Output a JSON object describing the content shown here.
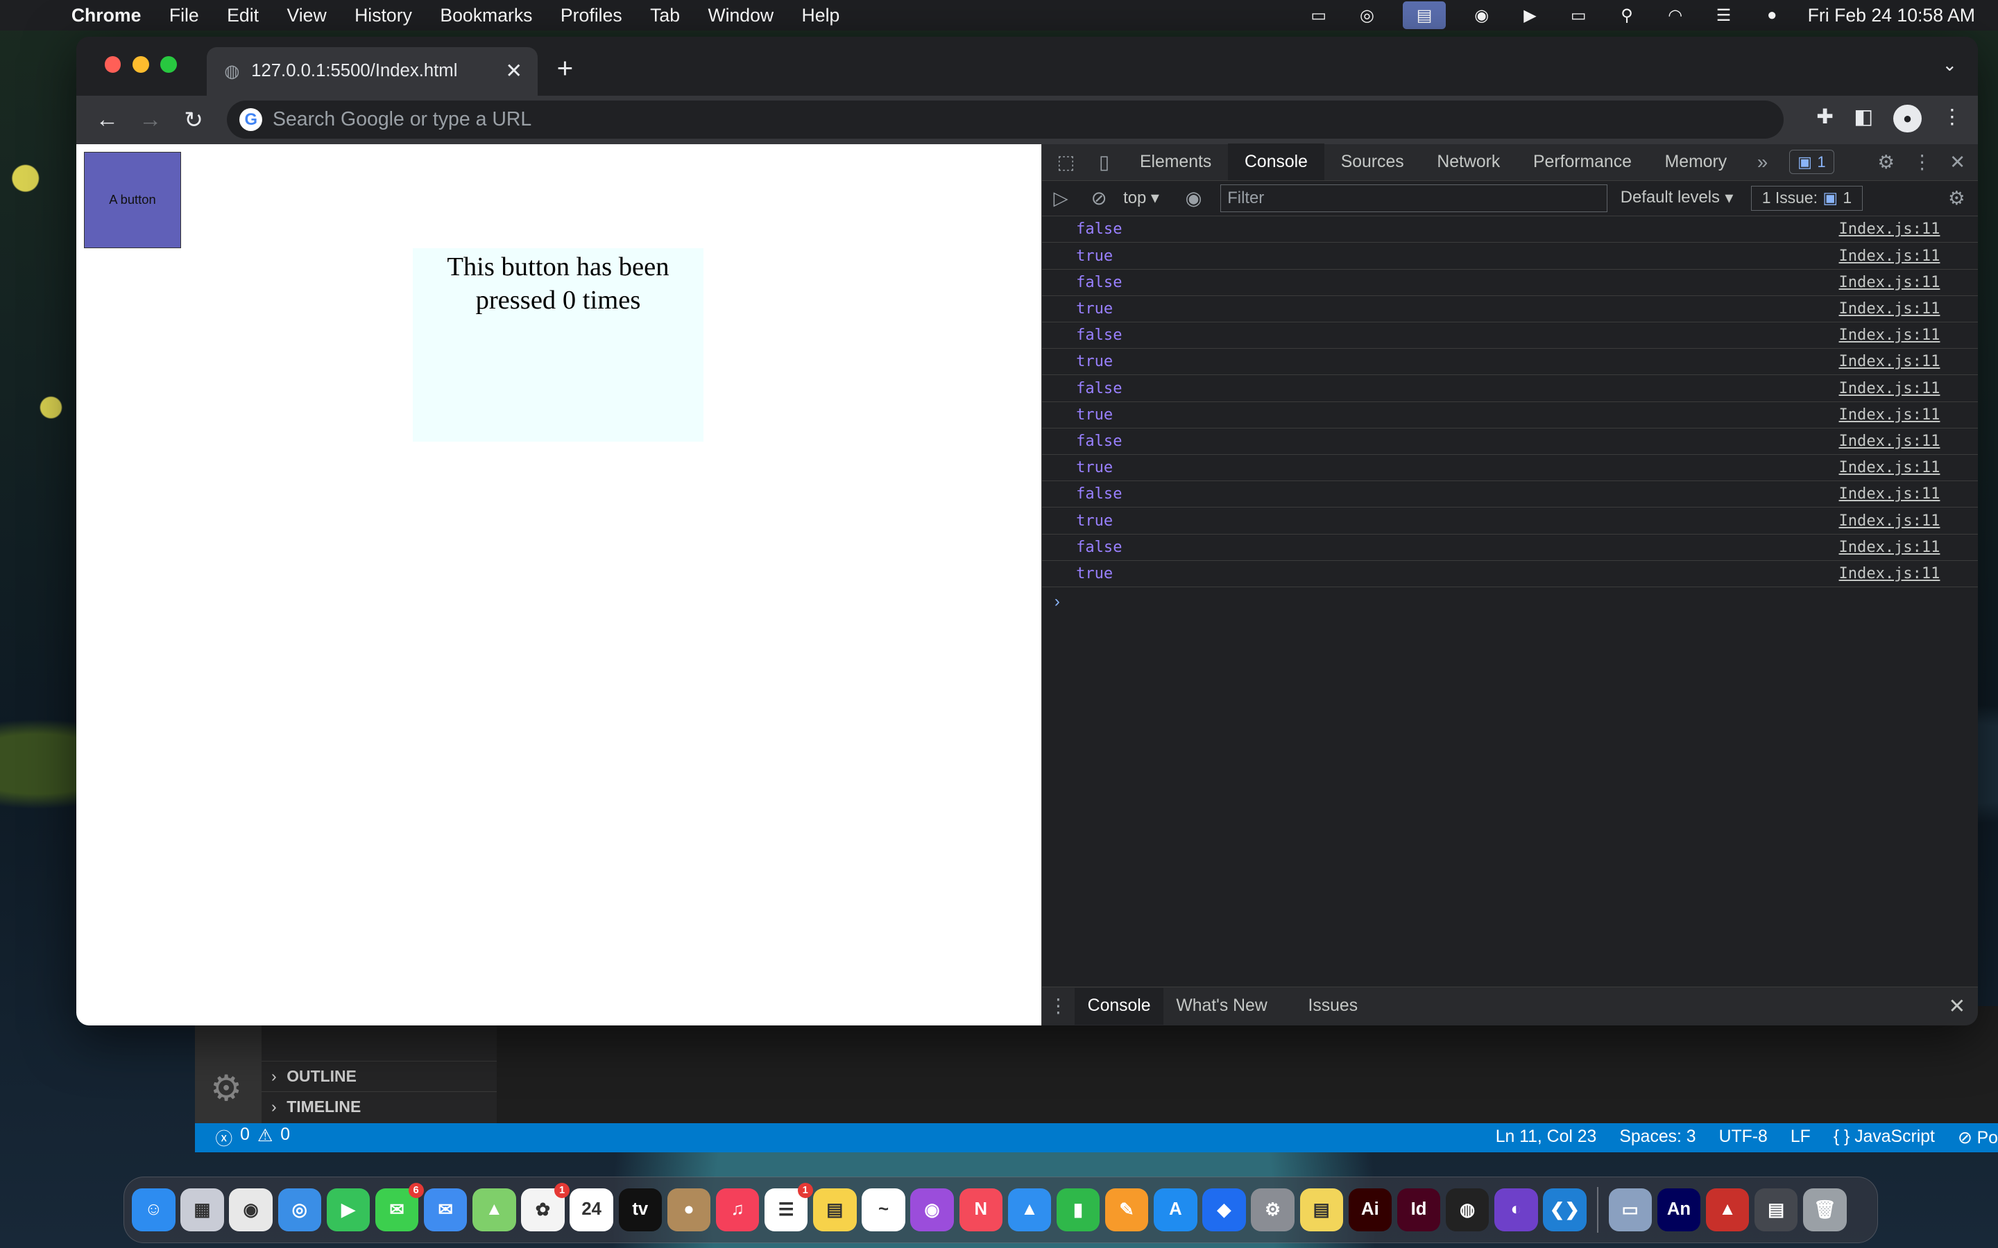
{
  "menubar": {
    "app": "Chrome",
    "items": [
      "File",
      "Edit",
      "View",
      "History",
      "Bookmarks",
      "Profiles",
      "Tab",
      "Window",
      "Help"
    ],
    "clock": "Fri Feb 24  10:58 AM"
  },
  "browser": {
    "tab_title": "127.0.0.1:5500/Index.html",
    "omnibox_placeholder": "Search Google or type a URL",
    "new_tab": "+",
    "tab_close": "✕"
  },
  "page": {
    "button_label": "A button",
    "counter_text": "This button has been pressed 0 times"
  },
  "devtools": {
    "tabs": [
      "Elements",
      "Console",
      "Sources",
      "Network",
      "Performance",
      "Memory"
    ],
    "active_tab": "Console",
    "issues_count": "1",
    "context": "top",
    "filter_placeholder": "Filter",
    "levels": "Default levels",
    "issue_label": "1 Issue:",
    "issue_count": "1",
    "logs": [
      {
        "value": "false",
        "source": "Index.js:11"
      },
      {
        "value": "true",
        "source": "Index.js:11"
      },
      {
        "value": "false",
        "source": "Index.js:11"
      },
      {
        "value": "true",
        "source": "Index.js:11"
      },
      {
        "value": "false",
        "source": "Index.js:11"
      },
      {
        "value": "true",
        "source": "Index.js:11"
      },
      {
        "value": "false",
        "source": "Index.js:11"
      },
      {
        "value": "true",
        "source": "Index.js:11"
      },
      {
        "value": "false",
        "source": "Index.js:11"
      },
      {
        "value": "true",
        "source": "Index.js:11"
      },
      {
        "value": "false",
        "source": "Index.js:11"
      },
      {
        "value": "true",
        "source": "Index.js:11"
      },
      {
        "value": "false",
        "source": "Index.js:11"
      },
      {
        "value": "true",
        "source": "Index.js:11"
      }
    ],
    "drawer_tabs": [
      "Console",
      "What's New",
      "Issues"
    ]
  },
  "vscode": {
    "outline": "OUTLINE",
    "timeline": "TIMELINE",
    "errors": "0",
    "warnings": "0",
    "position": "Ln 11, Col 23",
    "spaces": "Spaces: 3",
    "encoding": "UTF-8",
    "eol": "LF",
    "language": "JavaScript",
    "extra": "Po"
  },
  "dock": {
    "apps": [
      {
        "name": "finder-icon",
        "color": "#2d8cf0",
        "glyph": "☺"
      },
      {
        "name": "launchpad-icon",
        "color": "#c9ccd6",
        "glyph": "▦"
      },
      {
        "name": "chrome-icon",
        "color": "#e8e8e8",
        "glyph": "◉"
      },
      {
        "name": "safari-icon",
        "color": "#3a8ee6",
        "glyph": "◎"
      },
      {
        "name": "facetime-icon",
        "color": "#36c25a",
        "glyph": "▶"
      },
      {
        "name": "messages-icon",
        "color": "#3ccf4e",
        "glyph": "✉",
        "badge": "6"
      },
      {
        "name": "mail-icon",
        "color": "#3f8cf0",
        "glyph": "✉"
      },
      {
        "name": "maps-icon",
        "color": "#7fcf6a",
        "glyph": "▲"
      },
      {
        "name": "photos-icon",
        "color": "#f4f4f4",
        "glyph": "✿",
        "badge": "1"
      },
      {
        "name": "calendar-icon",
        "color": "#ffffff",
        "glyph": "24"
      },
      {
        "name": "tv-icon",
        "color": "#111111",
        "glyph": "tv"
      },
      {
        "name": "contacts-icon",
        "color": "#b08a5a",
        "glyph": "●"
      },
      {
        "name": "music-icon",
        "color": "#f5405a",
        "glyph": "♫"
      },
      {
        "name": "reminders-icon",
        "color": "#ffffff",
        "glyph": "☰",
        "badge": "1"
      },
      {
        "name": "notes-icon",
        "color": "#f7d24a",
        "glyph": "▤"
      },
      {
        "name": "freeform-icon",
        "color": "#ffffff",
        "glyph": "~"
      },
      {
        "name": "podcasts-icon",
        "color": "#9b4ddb",
        "glyph": "◉"
      },
      {
        "name": "news-icon",
        "color": "#f44a5a",
        "glyph": "N"
      },
      {
        "name": "keynote-icon",
        "color": "#2f8ff0",
        "glyph": "▲"
      },
      {
        "name": "numbers-icon",
        "color": "#2fb84a",
        "glyph": "▮"
      },
      {
        "name": "pages-icon",
        "color": "#f79a2a",
        "glyph": "✎"
      },
      {
        "name": "appstore-icon",
        "color": "#1f8cf0",
        "glyph": "A"
      },
      {
        "name": "dropbox-icon",
        "color": "#1f6cf0",
        "glyph": "◆"
      },
      {
        "name": "settings-icon",
        "color": "#8a8d94",
        "glyph": "⚙"
      },
      {
        "name": "stickies-icon",
        "color": "#f2d55a",
        "glyph": "▤"
      },
      {
        "name": "illustrator-icon",
        "color": "#330000",
        "glyph": "Ai"
      },
      {
        "name": "indesign-icon",
        "color": "#49021f",
        "glyph": "Id"
      },
      {
        "name": "blender-icon",
        "color": "#222222",
        "glyph": "◍"
      },
      {
        "name": "github-icon",
        "color": "#6e40c9",
        "glyph": "◐"
      },
      {
        "name": "vscode-icon",
        "color": "#1f7fd4",
        "glyph": "❮❯"
      },
      {
        "name": "preview-icon",
        "color": "#8aa0c0",
        "glyph": "▭"
      },
      {
        "name": "animate-icon",
        "color": "#00005b",
        "glyph": "An"
      },
      {
        "name": "acrobat-icon",
        "color": "#c8302a",
        "glyph": "▲"
      },
      {
        "name": "downloads-icon",
        "color": "#44474e",
        "glyph": "▤"
      },
      {
        "name": "trash-icon",
        "color": "#9aa0a6",
        "glyph": "🗑"
      }
    ]
  }
}
